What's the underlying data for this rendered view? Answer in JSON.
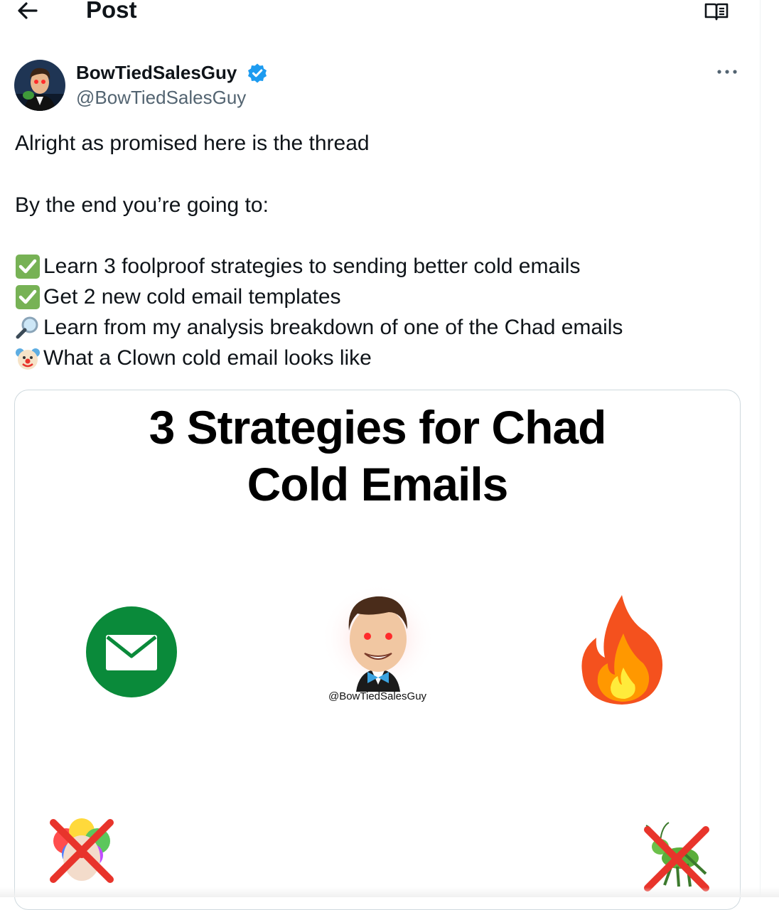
{
  "header": {
    "title": "Post",
    "back_icon": "arrow-left-icon",
    "reader_icon": "book-open-icon"
  },
  "author": {
    "display_name": "BowTiedSalesGuy",
    "handle": "@BowTiedSalesGuy",
    "verified": true,
    "more_icon": "ellipsis-icon"
  },
  "tweet": {
    "line1": "Alright as promised here is the thread",
    "line2": "By the end you’re going to:",
    "items": [
      {
        "icon": "check-mark-button-emoji",
        "text": "Learn 3 foolproof strategies to sending better cold emails"
      },
      {
        "icon": "check-mark-button-emoji",
        "text": "Get 2 new cold email templates"
      },
      {
        "icon": "magnifying-glass-emoji",
        "text": "Learn from my analysis breakdown of one of the Chad emails"
      },
      {
        "icon": "clown-face-emoji",
        "text": "What a Clown cold email looks like"
      }
    ]
  },
  "media": {
    "title_line1": "3 Strategies for Chad",
    "title_line2": "Cold Emails",
    "character_handle": "@BowTiedSalesGuy",
    "icons": [
      "envelope-icon",
      "character-illustration",
      "fire-icon",
      "clown-crossed-icon",
      "cricket-crossed-icon"
    ]
  },
  "colors": {
    "text": "#0f1419",
    "secondary": "#536471",
    "verified_blue": "#1d9bf0",
    "green_mail": "#0a8a3a",
    "check_green": "#77b255",
    "cross_red": "#e8342b"
  }
}
